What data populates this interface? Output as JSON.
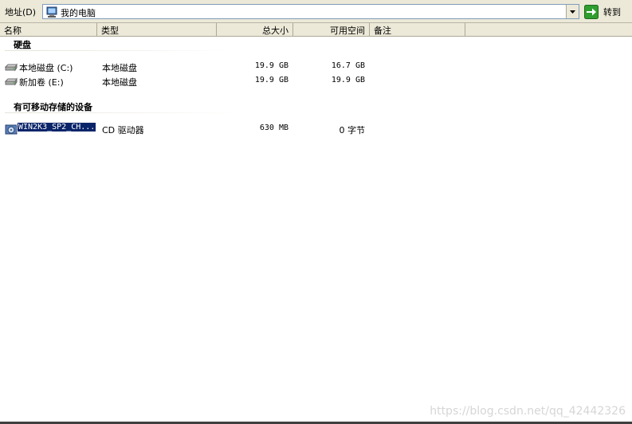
{
  "address_bar": {
    "label": "地址(D)",
    "value": "我的电脑",
    "go_label": "转到"
  },
  "columns": {
    "name": "名称",
    "type": "类型",
    "total_size": "总大小",
    "free_space": "可用空间",
    "remarks": "备注"
  },
  "groups": [
    {
      "title": "硬盘",
      "items": [
        {
          "name": "本地磁盘 (C:)",
          "type": "本地磁盘",
          "total": "19.9 GB",
          "free": "16.7 GB"
        },
        {
          "name": "新加卷 (E:)",
          "type": "本地磁盘",
          "total": "19.9 GB",
          "free": "19.9 GB"
        }
      ]
    },
    {
      "title": "有可移动存储的设备",
      "items": [
        {
          "name": "WIN2K3_SP2_CH...",
          "type": "CD 驱动器",
          "total": "630 MB",
          "free": "0 字节"
        }
      ]
    }
  ],
  "watermark": "https://blog.csdn.net/qq_42442326",
  "icons": {
    "computer": "computer-icon",
    "go": "go-arrow-icon",
    "drive": "hard-drive-icon",
    "cd": "cd-drive-icon"
  },
  "colors": {
    "selection": "#0a246a",
    "toolbar": "#ece9d8",
    "go_green": "#2f9e2f"
  }
}
